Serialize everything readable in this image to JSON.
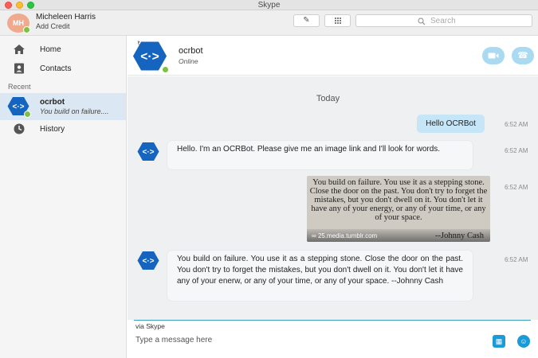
{
  "window": {
    "title": "Skype"
  },
  "profile": {
    "initials": "MH",
    "name": "Micheleen Harris",
    "credit_link": "Add Credit"
  },
  "toolbar": {
    "compose_icon": "compose-icon",
    "dialpad_icon": "dialpad-icon",
    "search_placeholder": "Search"
  },
  "sidebar": {
    "items": [
      {
        "label": "Home",
        "icon": "home-icon"
      },
      {
        "label": "Contacts",
        "icon": "contacts-icon"
      }
    ],
    "recent_label": "Recent",
    "recent": [
      {
        "name": "ocrbot",
        "snippet": "You build on failure...."
      }
    ],
    "history": {
      "label": "History",
      "icon": "clock-icon"
    }
  },
  "chat": {
    "contact_name": "ocrbot",
    "contact_status": "Online",
    "day_label": "Today",
    "messages": [
      {
        "direction": "out",
        "text": "Hello OCRBot",
        "time": "6:52 AM"
      },
      {
        "direction": "in",
        "text": "Hello.  I'm an OCRBot.  Please give me an image link and I'll look for words.",
        "time": "6:52 AM"
      },
      {
        "direction": "out",
        "type": "image",
        "image_text": "You build on failure. You use it as a stepping stone. Close the door on the past. You don't try to forget the mistakes, but you don't dwell on it. You don't let it have any of your energy, or any of your time, or any of your space.",
        "image_author": "--Johnny Cash",
        "image_link": "25.media.tumblr.com",
        "time": "6:52 AM"
      },
      {
        "direction": "in",
        "text": "You build on failure. You use it as a stepping stone. Close the door on the past. You don't try to forget the mistakes, but you don't dwell on it. You don't let it have any of your enerw, or any of your time, or any of your space. --Johnny Cash",
        "time": "6:52 AM"
      }
    ]
  },
  "compose": {
    "via": "via Skype",
    "placeholder": "Type a message here"
  },
  "colors": {
    "accent": "#1a9bd7",
    "bot_blue": "#1565c0",
    "online": "#7cc142",
    "selected_row": "#dbe8f3",
    "out_bubble": "#c6e5f7"
  }
}
